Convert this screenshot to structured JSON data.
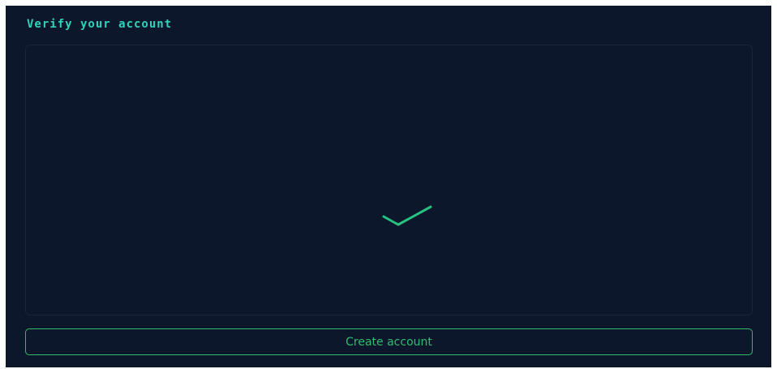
{
  "form": {
    "title": "Verify your account",
    "verification": {
      "status_icon": "checkmark-icon",
      "icon_color": "#27c281"
    },
    "submit_label": "Create account"
  },
  "colors": {
    "background": "#0c172b",
    "title": "#2fd3bb",
    "accent_green": "#2ebd6d"
  }
}
